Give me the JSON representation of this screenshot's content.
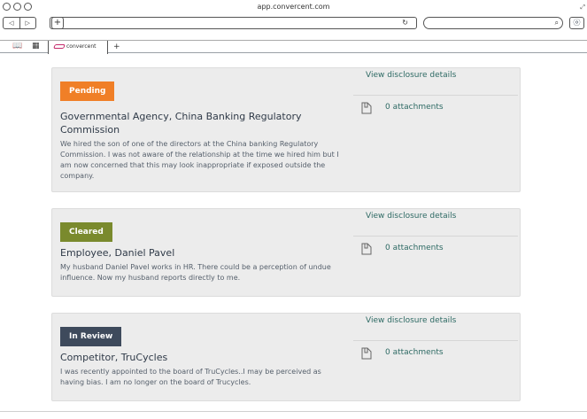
{
  "browser": {
    "url": "app.convercent.com",
    "tab_label": "convercent",
    "nav_back": "◁",
    "nav_forward": "▷",
    "plus": "+",
    "reload": "↻",
    "search_icon": "⌕",
    "downloads": "ⓞ",
    "bookmarks_icon": "book-icon",
    "apps_icon": "grid-icon"
  },
  "disclosures": [
    {
      "status": "Pending",
      "status_color": "#f07f27",
      "title": "Governmental Agency, China Banking Regulatory Commission",
      "description": "We hired the son of one of the directors at the China banking Regulatory Commission. I was not aware of the relationship at the time we hired him but I am now concerned that this may look inappropriate if exposed outside the company.",
      "view_link": "View disclosure details",
      "attachments": "0 attachments"
    },
    {
      "status": "Cleared",
      "status_color": "#7a8a2d",
      "title": "Employee, Daniel Pavel",
      "description": "My husband Daniel Pavel works in HR. There could be a perception of undue influence. Now my husband reports directly to me.",
      "view_link": "View disclosure details",
      "attachments": "0 attachments"
    },
    {
      "status": "In Review",
      "status_color": "#3e4a5c",
      "title": "Competitor, TruCycles",
      "description": "I was recently appointed to the board of TruCycles..I may be perceived as having bias. I am no longer on the board of Trucycles.",
      "view_link": "View disclosure details",
      "attachments": "0 attachments"
    }
  ]
}
